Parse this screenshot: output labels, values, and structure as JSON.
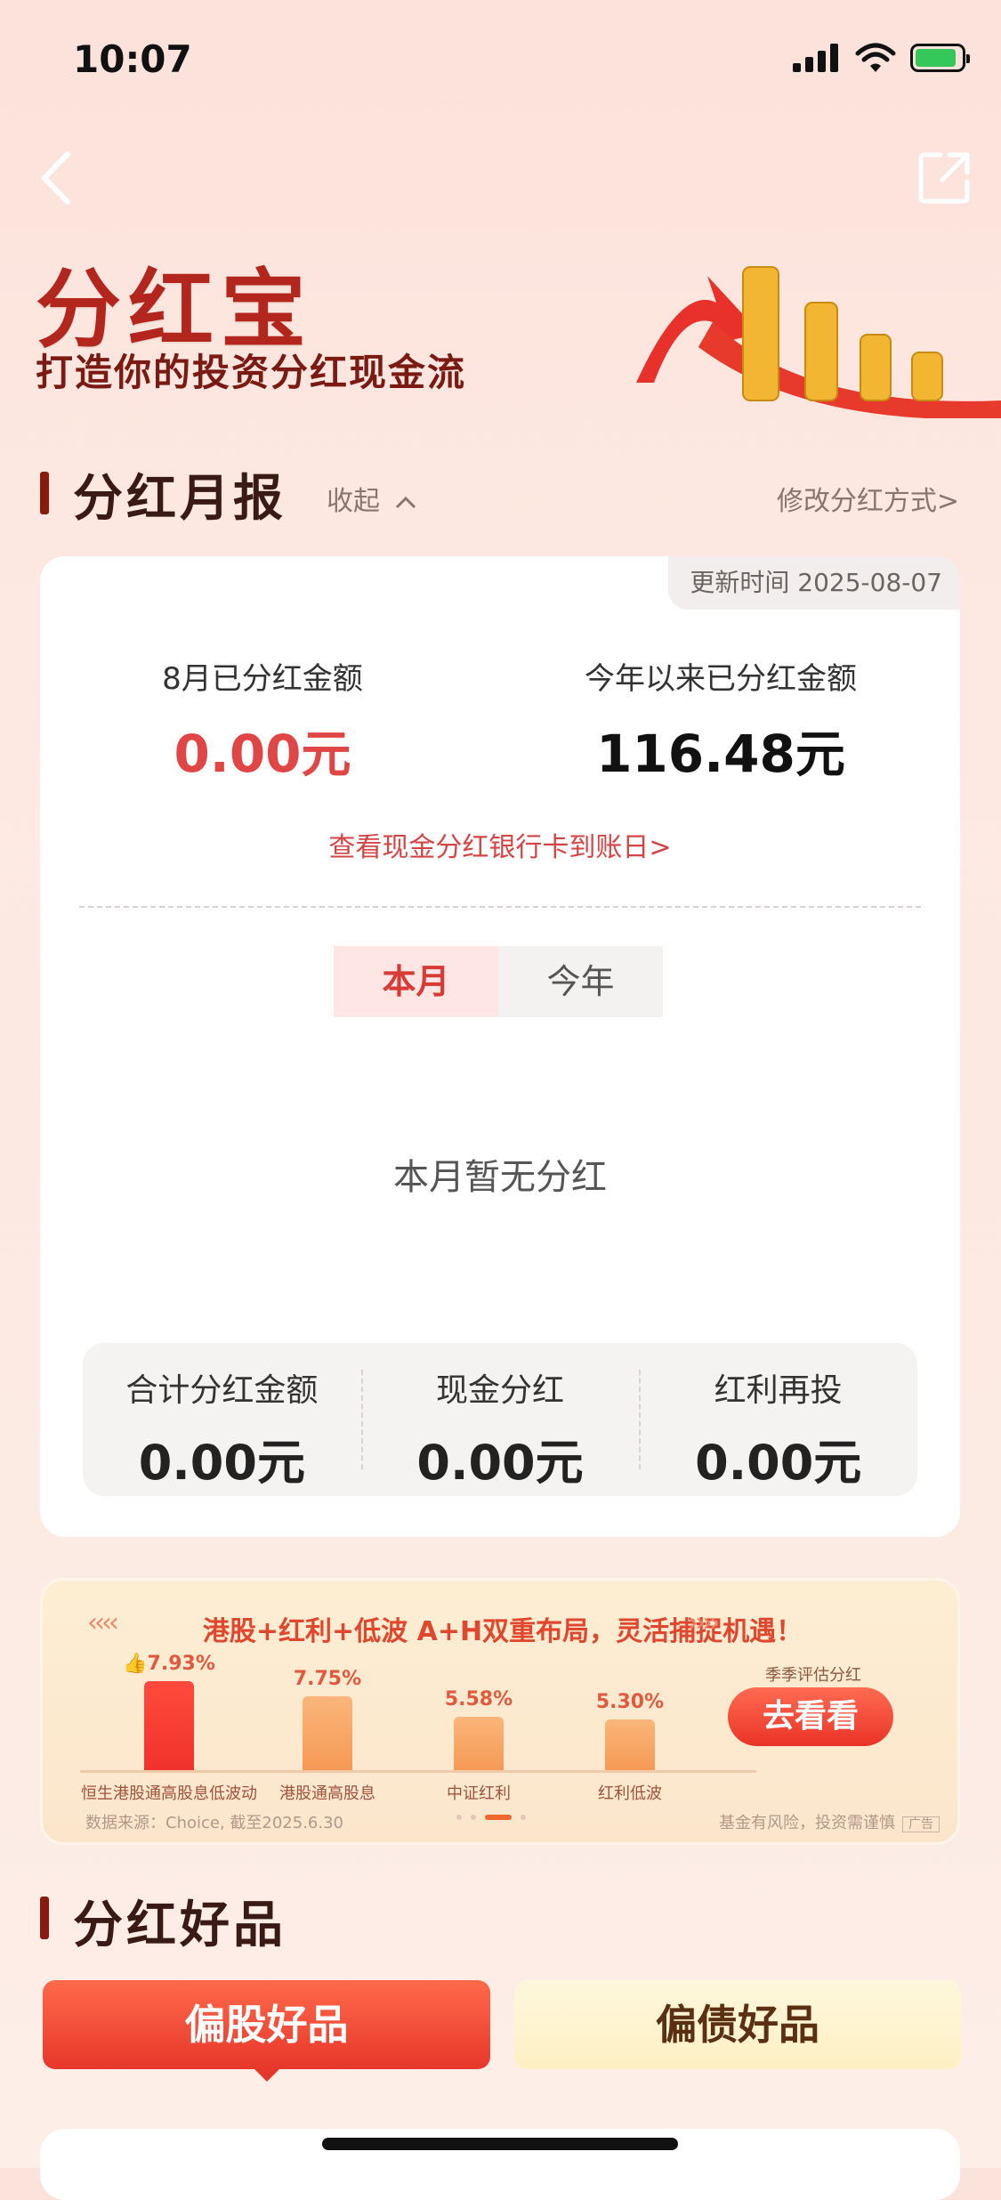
{
  "status_bar": {
    "time": "10:07"
  },
  "hero": {
    "title": "分红宝",
    "subtitle": "打造你的投资分红现金流"
  },
  "monthly_report": {
    "title": "分红月报",
    "collapse_label": "收起",
    "modify_label": "修改分红方式>",
    "update_time": "更新时间 2025-08-07",
    "month_label": "8月已分红金额",
    "month_value": "0.00",
    "year_label": "今年以来已分红金额",
    "year_value": "116.48",
    "unit": "元",
    "bank_link": "查看现金分红银行卡到账日>",
    "segments": {
      "current": "本月",
      "other": "今年"
    },
    "empty_text": "本月暂无分红",
    "totals": [
      {
        "label": "合计分红金额",
        "value": "0.00元"
      },
      {
        "label": "现金分红",
        "value": "0.00元"
      },
      {
        "label": "红利再投",
        "value": "0.00元"
      }
    ]
  },
  "banner": {
    "headline": "港股+红利+低波  A+H双重布局，灵活捕捉机遇！",
    "bars": [
      {
        "name": "恒生港股通高股息低波动",
        "value": "7.93%",
        "pct": 7.93
      },
      {
        "name": "港股通高股息",
        "value": "7.75%",
        "pct": 7.75
      },
      {
        "name": "中证红利",
        "value": "5.58%",
        "pct": 5.58
      },
      {
        "name": "红利低波",
        "value": "5.30%",
        "pct": 5.3
      }
    ],
    "quarter_note": "季季评估分红",
    "button": "去看看",
    "source": "数据来源：Choice, 截至2025.6.30",
    "risk": "基金有风险，投资需谨慎",
    "ad_tag": "广告",
    "colors": {
      "top_bar": "#f0322c",
      "other_bars": "#f59a55"
    }
  },
  "products": {
    "title": "分红好品",
    "tab_equity": "偏股好品",
    "tab_bond": "偏债好品"
  }
}
